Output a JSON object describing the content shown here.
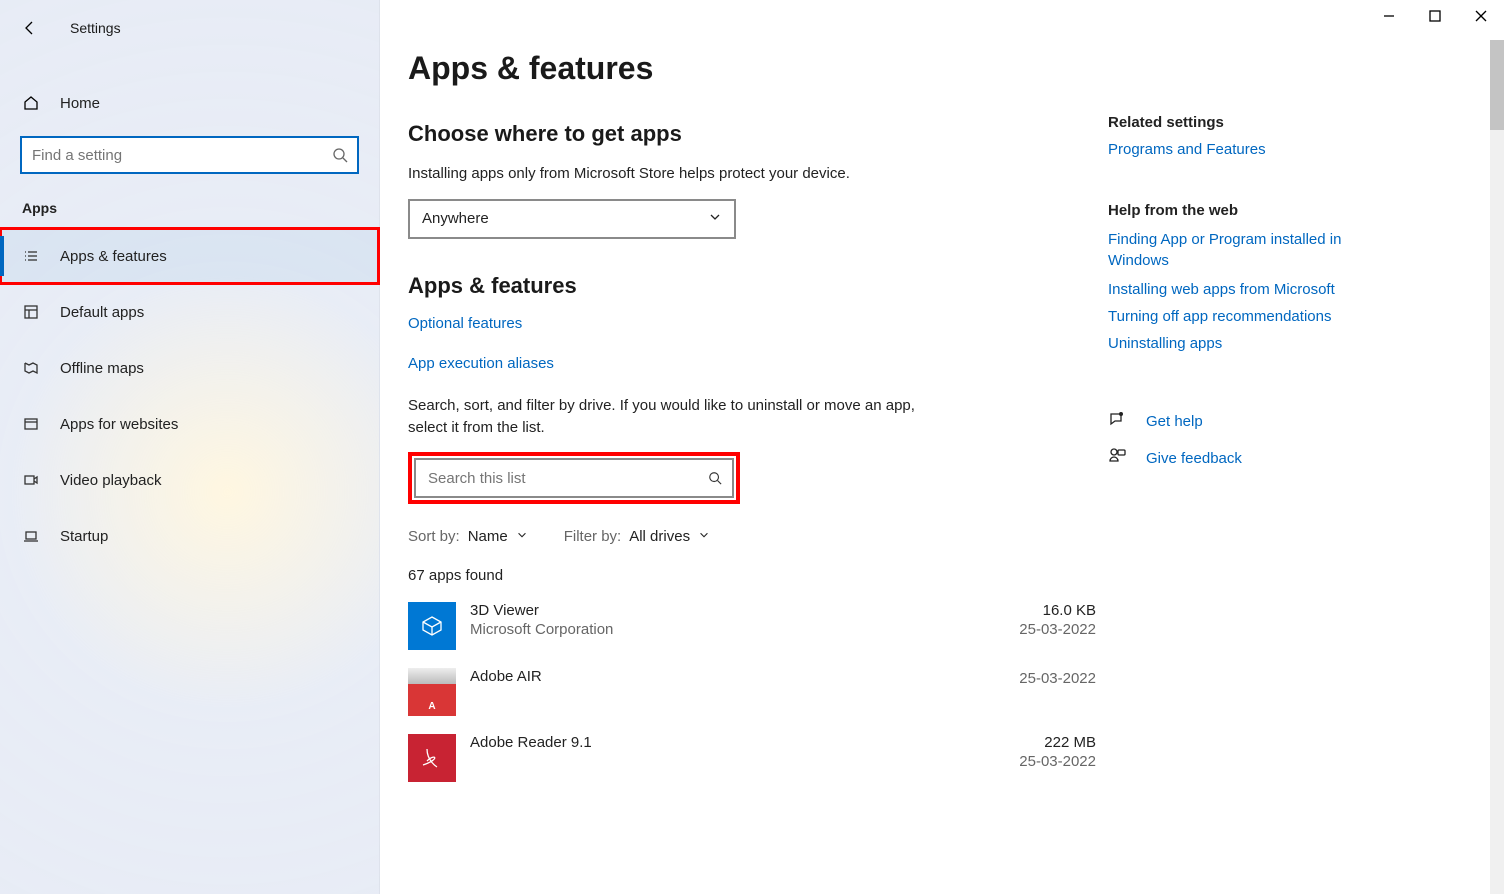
{
  "window": {
    "title": "Settings"
  },
  "sidebar": {
    "home": "Home",
    "search_placeholder": "Find a setting",
    "section": "Apps",
    "items": [
      {
        "label": "Apps & features"
      },
      {
        "label": "Default apps"
      },
      {
        "label": "Offline maps"
      },
      {
        "label": "Apps for websites"
      },
      {
        "label": "Video playback"
      },
      {
        "label": "Startup"
      }
    ]
  },
  "main": {
    "heading": "Apps & features",
    "sub1_heading": "Choose where to get apps",
    "sub1_text": "Installing apps only from Microsoft Store helps protect your device.",
    "dropdown_value": "Anywhere",
    "sub2_heading": "Apps & features",
    "link_optional": "Optional features",
    "link_aliases": "App execution aliases",
    "filter_text": "Search, sort, and filter by drive. If you would like to uninstall or move an app, select it from the list.",
    "list_search_placeholder": "Search this list",
    "sort_prefix": "Sort by:",
    "sort_value": "Name",
    "filter_prefix": "Filter by:",
    "filter_value": "All drives",
    "count": "67 apps found",
    "apps": [
      {
        "name": "3D Viewer",
        "publisher": "Microsoft Corporation",
        "size": "16.0 KB",
        "date": "25-03-2022"
      },
      {
        "name": "Adobe AIR",
        "publisher": "",
        "size": "",
        "date": "25-03-2022"
      },
      {
        "name": "Adobe Reader 9.1",
        "publisher": "",
        "size": "222 MB",
        "date": "25-03-2022"
      }
    ]
  },
  "right": {
    "related_heading": "Related settings",
    "related_link": "Programs and Features",
    "help_heading": "Help from the web",
    "help_links": [
      "Finding App or Program installed in Windows",
      "Installing web apps from Microsoft",
      "Turning off app recommendations",
      "Uninstalling apps"
    ],
    "get_help": "Get help",
    "give_feedback": "Give feedback"
  }
}
